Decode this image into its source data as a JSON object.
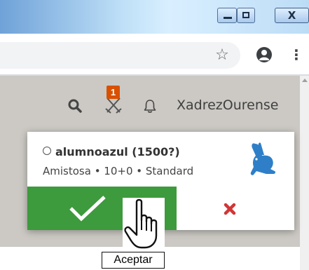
{
  "window": {
    "buttons": [
      {
        "name": "minimize-button",
        "icon": "minimize-icon"
      },
      {
        "name": "maximize-button",
        "icon": "maximize-icon"
      },
      {
        "name": "close-button",
        "icon": "close-icon",
        "label": "X"
      }
    ]
  },
  "browser": {
    "icons": [
      "star-icon",
      "account-icon",
      "more-vert-icon"
    ],
    "more_label": "⋮"
  },
  "site_nav": {
    "icons": [
      "search-icon",
      "crossed-swords-icon",
      "bell-icon"
    ],
    "challenge_count": "1",
    "username": "XadrezOurense"
  },
  "challenge": {
    "opponent": "alumnoazul (1500?)",
    "details": "Amistosa • 10+0 • Standard",
    "variant_icon": "rabbit-icon",
    "accept_icon": "checkmark-icon",
    "decline_icon": "cross-icon"
  },
  "tooltip": {
    "text": "Aceptar"
  },
  "colors": {
    "accept": "#3d9a3d",
    "decline": "#d13636",
    "badge": "#d85000",
    "rabbit": "#2f7fc8"
  }
}
